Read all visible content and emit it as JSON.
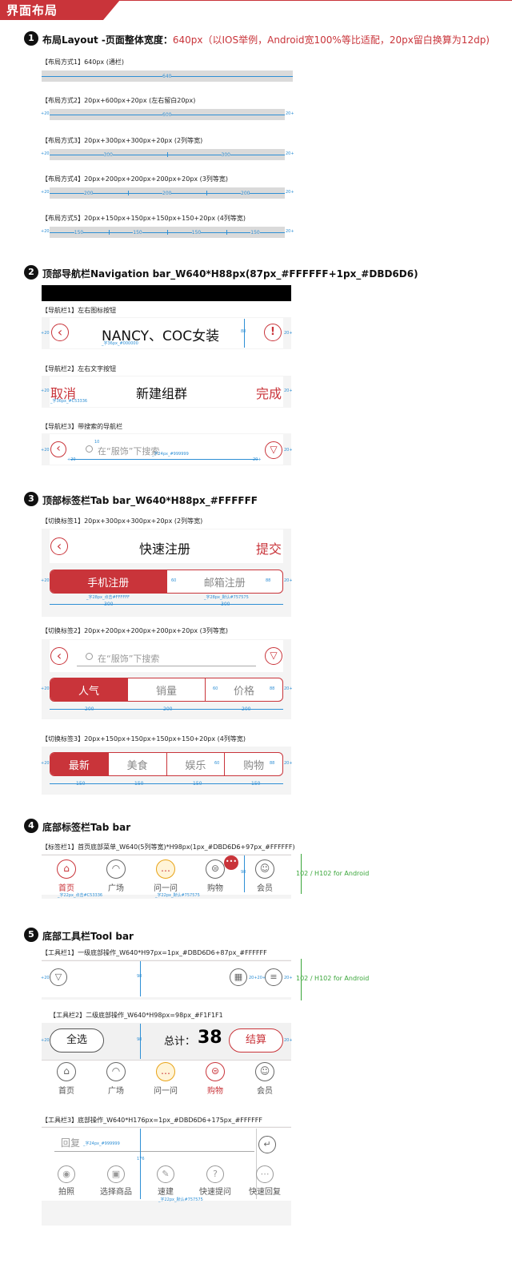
{
  "header": {
    "title": "界面布局"
  },
  "s1": {
    "num": "1",
    "title": "布局Layout -页面整体宽度：",
    "title_red": "640px（以IOS举例，Android宽100%等比适配，20px留白换算为12dp)",
    "rows": [
      {
        "label": "【布局方式1】640px (通栏)",
        "marks": [
          "640"
        ]
      },
      {
        "label": "【布局方式2】20px+600px+20px (左右留白20px)",
        "marks": [
          "600"
        ]
      },
      {
        "label": "【布局方式3】20px+300px+300px+20px (2列等宽)",
        "marks": [
          "300",
          "300"
        ]
      },
      {
        "label": "【布局方式4】20px+200px+200px+200px+20px (3列等宽)",
        "marks": [
          "200",
          "200",
          "200"
        ]
      },
      {
        "label": "【布局方式5】20px+150px+150px+150px+150+20px (4列等宽)",
        "marks": [
          "150",
          "150",
          "150",
          "150"
        ]
      }
    ],
    "side": "20"
  },
  "s2": {
    "num": "2",
    "title": "顶部导航栏Navigation bar_W640*H88px(87px_#FFFFFF+1px_#DBD6D6)",
    "n1": {
      "label": "【导航栏1】左右图标按钮",
      "title": "NANCY、COC女装",
      "spec": "_字36px_#000000",
      "h": "88",
      "left_icon": "‹",
      "right_icon": "!"
    },
    "n2": {
      "label": "【导航栏2】左右文字按钮",
      "left": "取消",
      "title": "新建组群",
      "right": "完成",
      "spec": "_字36px_#C53336"
    },
    "n3": {
      "label": "【导航栏3】带搜索的导航栏",
      "placeholder": "在“服饰”下搜索",
      "spec": "_字24px_#999999",
      "ten": "10"
    }
  },
  "s3": {
    "num": "3",
    "title": "顶部标签栏Tab bar_W640*H88px_#FFFFFF",
    "t1": {
      "label": "【切换标签1】20px+300px+300px+20px (2列等宽)",
      "nav_title": "快速注册",
      "nav_right": "提交",
      "tabs": [
        "手机注册",
        "邮箱注册"
      ],
      "spec1": "_字28px_点击#FFFFFF",
      "spec2": "_字28px_默认#757575",
      "w": "300",
      "h": "60",
      "h2": "88"
    },
    "t2": {
      "label": "【切换标签2】20px+200px+200px+200px+20px (3列等宽)",
      "placeholder": "在“服饰”下搜索",
      "tabs": [
        "人气",
        "销量",
        "价格"
      ],
      "w": "200",
      "h": "60",
      "h2": "88"
    },
    "t3": {
      "label": "【切换标签3】20px+150px+150px+150px+150+20px (4列等宽)",
      "tabs": [
        "最新",
        "美食",
        "娱乐",
        "购物"
      ],
      "w": "150",
      "h": "60",
      "h2": "88"
    }
  },
  "s4": {
    "num": "4",
    "title": "底部标签栏Tab bar",
    "label": "【标签栏1】首页底部菜单_W640(5列等宽)*H98px(1px_#DBD6D6+97px_#FFFFFF)",
    "items": [
      "首页",
      "广场",
      "问一问",
      "购物",
      "会员"
    ],
    "spec1": "_字22px_点击#C53336",
    "spec2": "_字22px_默认#757575",
    "h": "98",
    "note": "102 / H102 for Android",
    "badge": "•••"
  },
  "s5": {
    "num": "5",
    "title": "底部工具栏Tool bar",
    "b1": {
      "label": "【工具栏1】一级底部操作_W640*H97px=1px_#DBD6D6+87px_#FFFFFF",
      "h": "98",
      "note": "102 / H102 for Android"
    },
    "b2": {
      "label": "【工具栏2】二级底部操作_W640*H98px=98px_#F1F1F1",
      "select_all": "全选",
      "total_label": "总计：",
      "total_value": "38",
      "checkout": "结算",
      "h": "98"
    },
    "tabs": [
      "首页",
      "广场",
      "问一问",
      "购物",
      "会员"
    ],
    "b3": {
      "label": "【工具栏3】底部操作_W640*H176px=1px_#DBD6D6+175px_#FFFFFF",
      "reply": "回复",
      "spec": "_字24px_#999999",
      "h": "176",
      "items": [
        "拍照",
        "选择商品",
        "速建",
        "快速提问",
        "快速回复"
      ],
      "spec2": "_字22px_默认#757575"
    }
  }
}
